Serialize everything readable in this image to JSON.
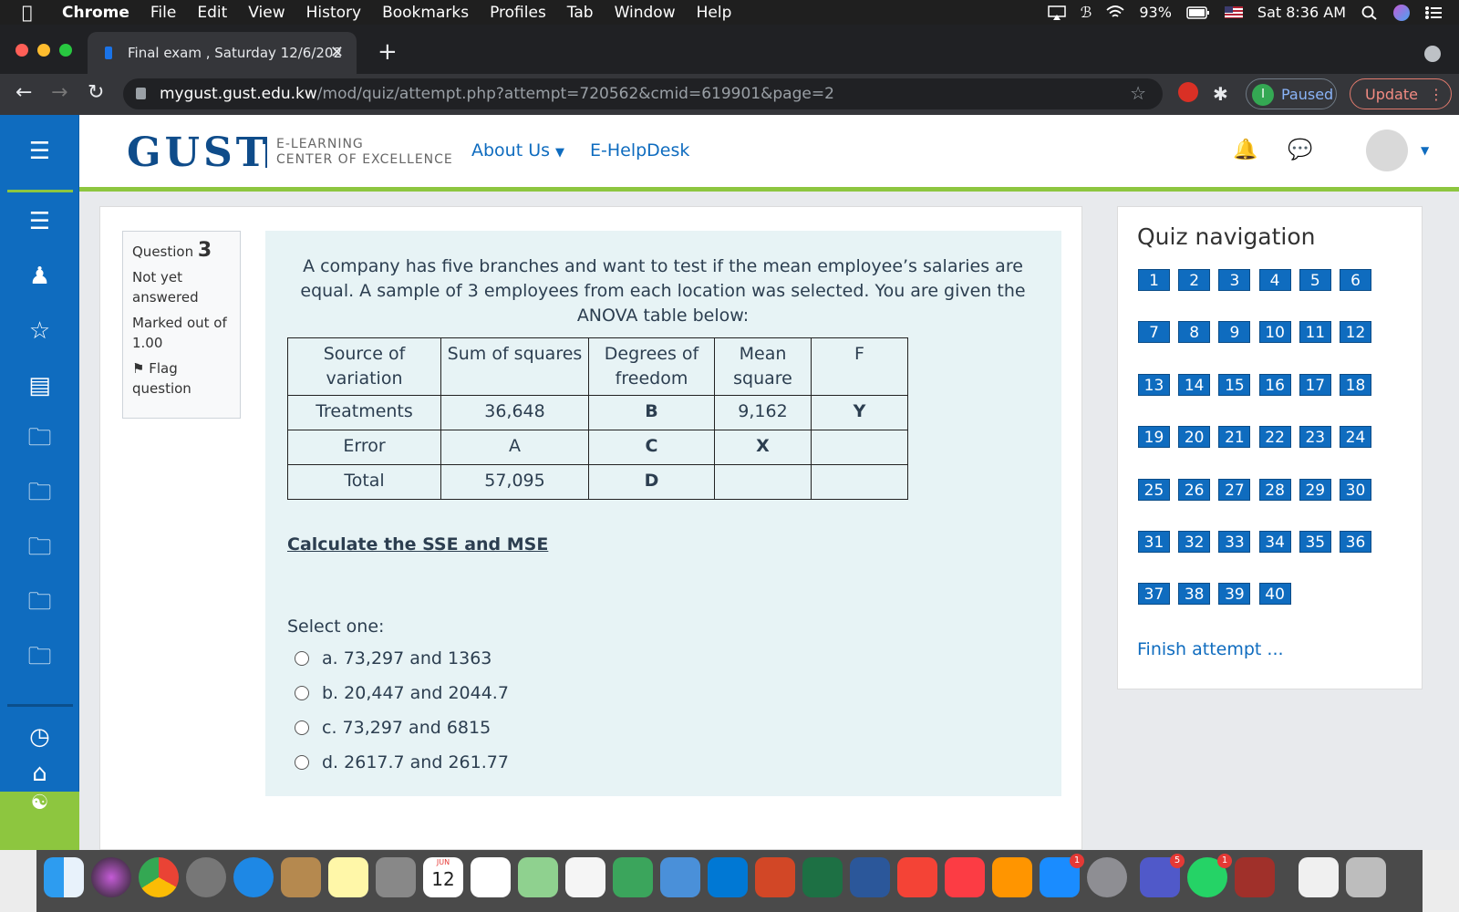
{
  "menubar": {
    "app": "Chrome",
    "items": [
      "File",
      "Edit",
      "View",
      "History",
      "Bookmarks",
      "Profiles",
      "Tab",
      "Window",
      "Help"
    ],
    "battery": "93%",
    "clock": "Sat 8:36 AM"
  },
  "browser": {
    "tab_title": "Final exam , Saturday 12/6/202",
    "url_host": "mygust.gust.edu.kw",
    "url_path": "/mod/quiz/attempt.php?attempt=720562&cmid=619901&page=2",
    "profile_initial": "I",
    "profile_status": "Paused",
    "update_label": "Update"
  },
  "site": {
    "logo": "GUST",
    "logo_sub_1": "E-LEARNING",
    "logo_sub_2": "CENTER OF EXCELLENCE",
    "nav_about": "About Us",
    "nav_helpdesk": "E-HelpDesk"
  },
  "question": {
    "label": "Question",
    "number": "3",
    "status": "Not yet answered",
    "marks": "Marked out of 1.00",
    "flag": "Flag question",
    "text": "A company has five branches  and want to test if the mean employee’s salaries are equal. A sample of 3 employees from each location was selected. You are given the ANOVA table below:",
    "table": {
      "headers": [
        "Source of variation",
        "Sum of squares",
        "Degrees of freedom",
        "Mean square",
        "F"
      ],
      "rows": [
        [
          "Treatments",
          "36,648",
          "B",
          "9,162",
          "Y"
        ],
        [
          "Error",
          "A",
          "C",
          "X",
          ""
        ],
        [
          "Total",
          "57,095",
          "D",
          "",
          ""
        ]
      ]
    },
    "prompt": "Calculate the SSE and MSE",
    "select_label": "Select one:",
    "options": [
      "a. 73,297 and 1363",
      "b. 20,447 and 2044.7",
      "c. 73,297 and 6815",
      "d. 2617.7 and 261.77"
    ]
  },
  "quiz_nav": {
    "title": "Quiz navigation",
    "buttons": [
      "1",
      "2",
      "3",
      "4",
      "5",
      "6",
      "7",
      "8",
      "9",
      "10",
      "11",
      "12",
      "13",
      "14",
      "15",
      "16",
      "17",
      "18",
      "19",
      "20",
      "21",
      "22",
      "23",
      "24",
      "25",
      "26",
      "27",
      "28",
      "29",
      "30",
      "31",
      "32",
      "33",
      "34",
      "35",
      "36",
      "37",
      "38",
      "39",
      "40"
    ],
    "finish": "Finish attempt ..."
  },
  "dock": {
    "calendar_month": "JUN",
    "calendar_day": "12",
    "badges": {
      "appstore": "1",
      "teams": "5",
      "whatsapp": "1"
    }
  },
  "colors": {
    "moodle_blue": "#0f6cbf",
    "accent_green": "#8dc63f",
    "question_bg": "#e7f3f5"
  }
}
